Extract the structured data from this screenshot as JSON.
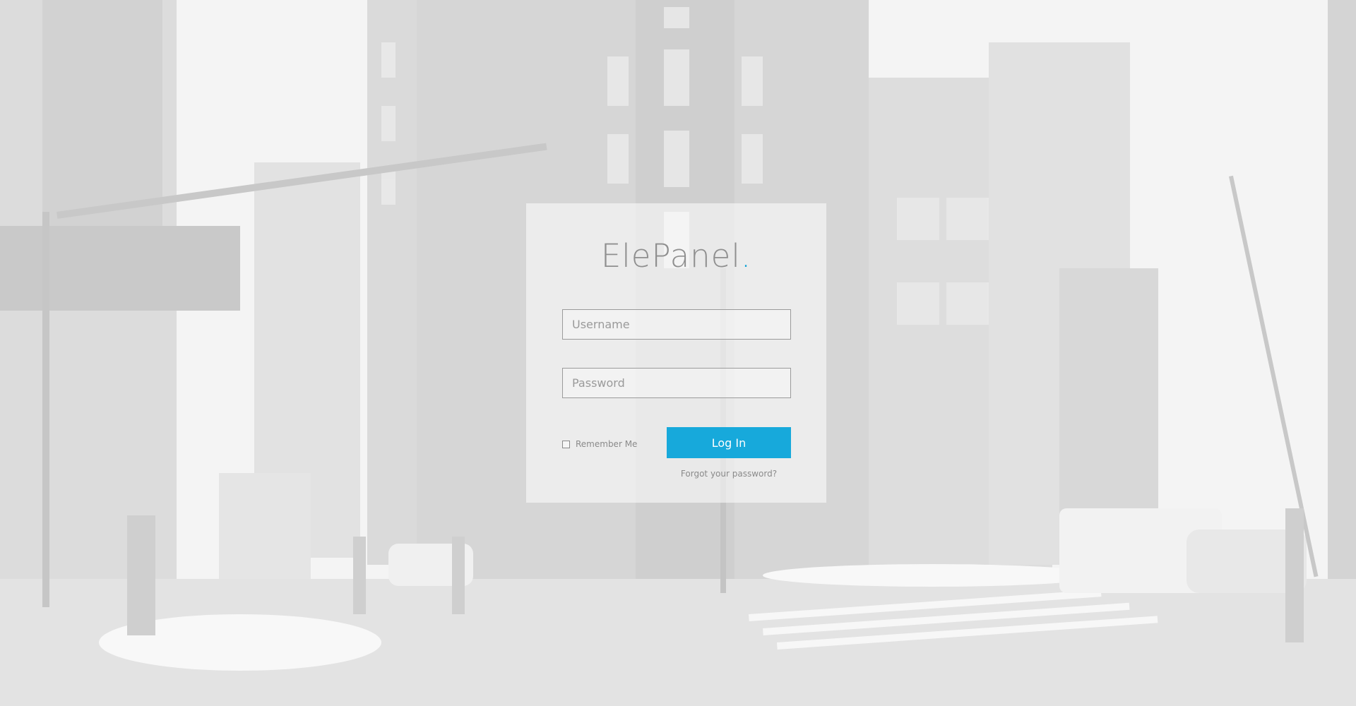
{
  "brand": {
    "name": "ElePanel",
    "dot": ".",
    "accent_color": "#1ba6d6"
  },
  "login_form": {
    "username_placeholder": "Username",
    "username_value": "",
    "password_placeholder": "Password",
    "password_value": "",
    "remember_label": "Remember Me",
    "remember_checked": false,
    "login_label": "Log In",
    "login_color": "#17a9db",
    "forgot_label": "Forgot your password?"
  },
  "background": {
    "description_icon": "city-street-photo"
  }
}
